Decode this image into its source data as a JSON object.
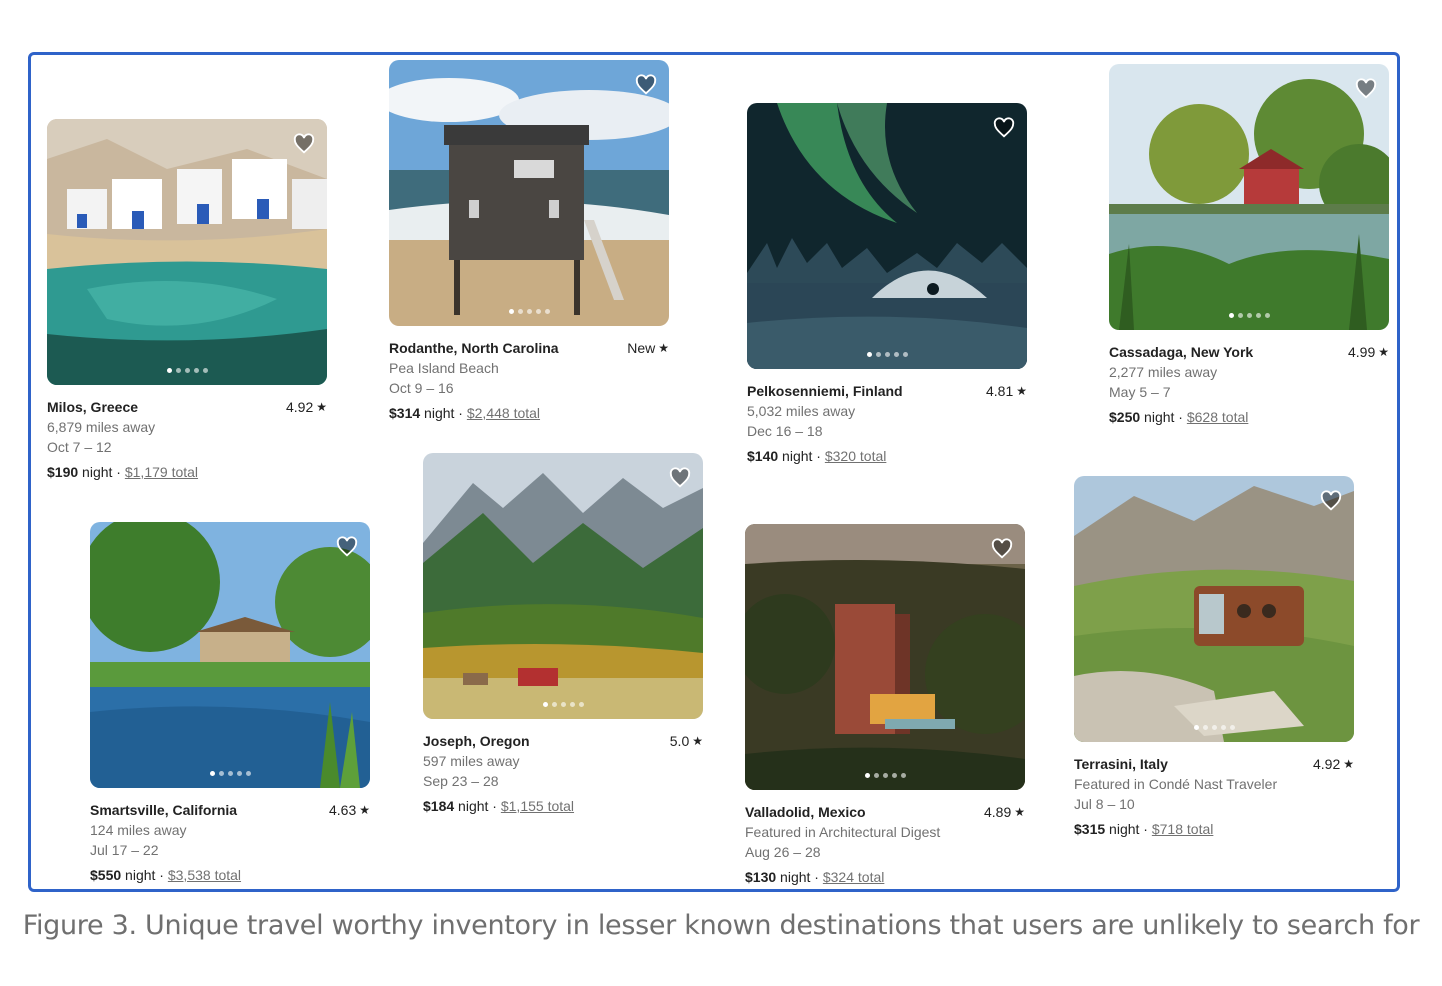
{
  "listings": [
    {
      "location": "Milos, Greece",
      "rating": "4.92",
      "line2": "6,879 miles away",
      "dates": "Oct 7 – 12",
      "price": "$190",
      "night_label": "night",
      "separator": "·",
      "total": "$1,179 total",
      "icon": "heart-icon"
    },
    {
      "location": "Rodanthe, North Carolina",
      "rating": "New",
      "line2": "Pea Island Beach",
      "dates": "Oct 9 – 16",
      "price": "$314",
      "night_label": "night",
      "separator": "·",
      "total": "$2,448 total",
      "icon": "heart-icon"
    },
    {
      "location": "Pelkosenniemi, Finland",
      "rating": "4.81",
      "line2": "5,032 miles away",
      "dates": "Dec 16 – 18",
      "price": "$140",
      "night_label": "night",
      "separator": "·",
      "total": "$320 total",
      "icon": "heart-icon"
    },
    {
      "location": "Cassadaga, New York",
      "rating": "4.99",
      "line2": "2,277 miles away",
      "dates": "May 5 – 7",
      "price": "$250",
      "night_label": "night",
      "separator": "·",
      "total": "$628 total",
      "icon": "heart-icon"
    },
    {
      "location": "Smartsville, California",
      "rating": "4.63",
      "line2": "124 miles away",
      "dates": "Jul 17 – 22",
      "price": "$550",
      "night_label": "night",
      "separator": "·",
      "total": "$3,538 total",
      "icon": "heart-icon"
    },
    {
      "location": "Joseph, Oregon",
      "rating": "5.0",
      "line2": "597 miles away",
      "dates": "Sep 23 – 28",
      "price": "$184",
      "night_label": "night",
      "separator": "·",
      "total": "$1,155 total",
      "icon": "heart-icon"
    },
    {
      "location": "Valladolid, Mexico",
      "rating": "4.89",
      "line2": "Featured in Architectural Digest",
      "dates": "Aug 26 – 28",
      "price": "$130",
      "night_label": "night",
      "separator": "·",
      "total": "$324 total",
      "icon": "heart-icon"
    },
    {
      "location": "Terrasini, Italy",
      "rating": "4.92",
      "line2": "Featured in Condé Nast Traveler",
      "dates": "Jul 8 – 10",
      "price": "$315",
      "night_label": "night",
      "separator": "·",
      "total": "$718 total",
      "icon": "heart-icon"
    }
  ],
  "star_glyph": "★",
  "caption": "Figure 3. Unique travel worthy inventory in lesser known destinations that users are unlikely to search for",
  "colors": {
    "frame_border": "#2f63c9",
    "text_primary": "#222222",
    "text_secondary": "#717171"
  }
}
